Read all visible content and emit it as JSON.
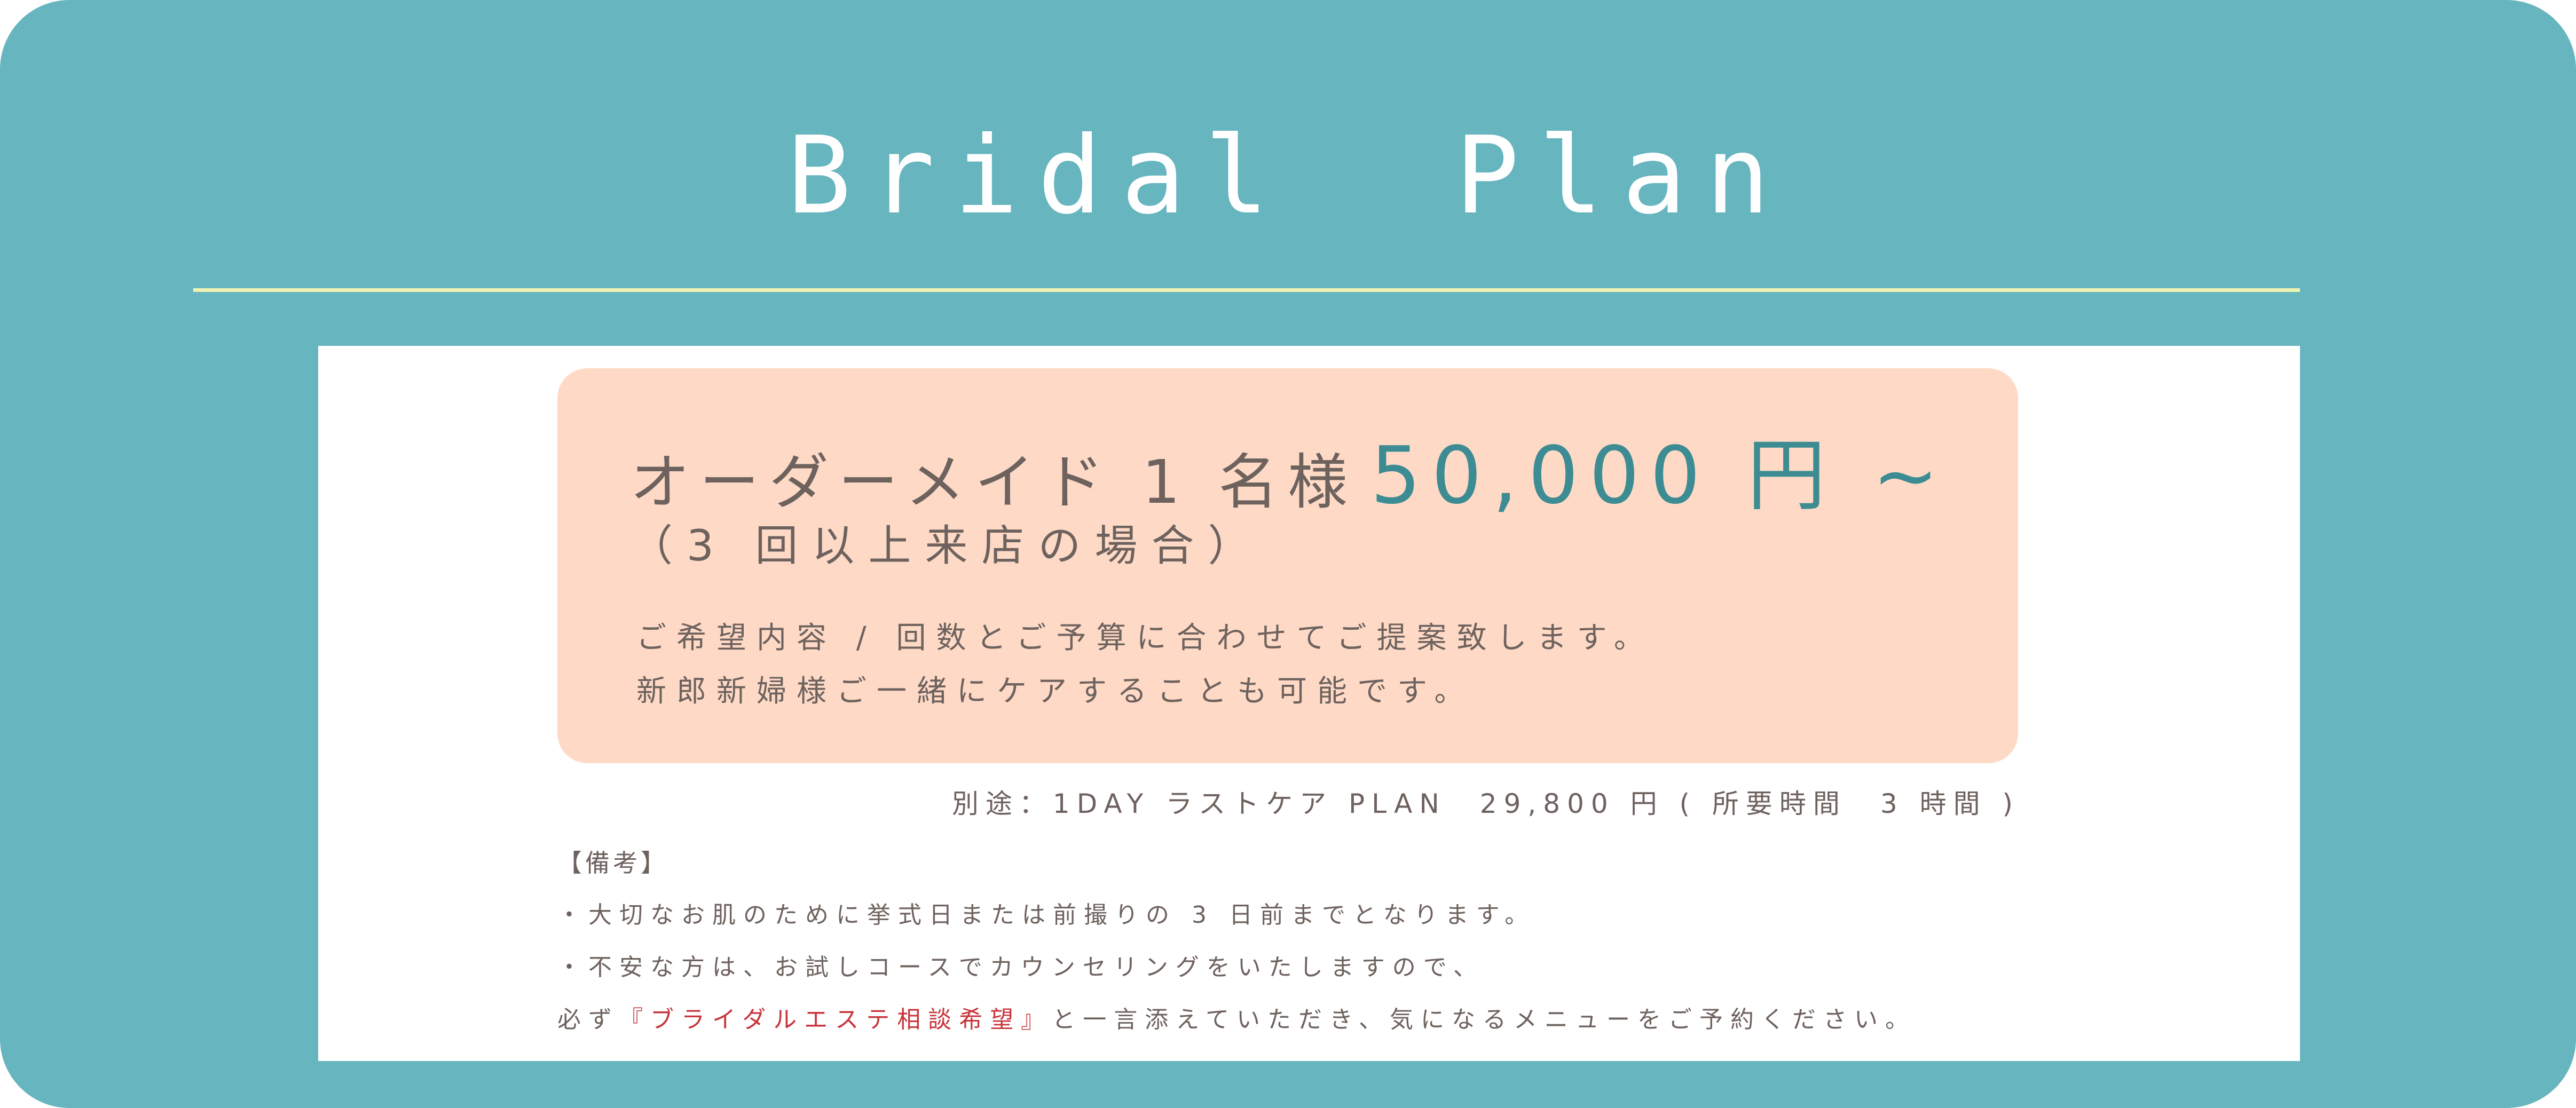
{
  "header": {
    "title": "Bridal  Plan"
  },
  "plan": {
    "name": "オーダーメイド 1 名様",
    "price": "50,000 円 ~",
    "condition": "（3 回以上来店の場合）",
    "description_lines": [
      "ご希望内容 / 回数とご予算に合わせてご提案致します。",
      "新郎新婦様ご一緒にケアすることも可能です。"
    ]
  },
  "extra_plan": "別途：1DAY ラストケア PLAN　29,800 円 ( 所要時間　3 時間 )",
  "notes": {
    "heading": "【備考】",
    "line1": "・大切なお肌のために挙式日または前撮りの 3 日前までとなります。",
    "line2": "・不安な方は、お試しコースでカウンセリングをいたしますので、",
    "line3_prefix": "必ず",
    "line3_highlight": "『ブライダルエステ相談希望』",
    "line3_suffix": "と一言添えていただき、気になるメニューをご予約ください。"
  },
  "colors": {
    "background": "#67b5bf",
    "divider": "#eef3b2",
    "price_box": "#fedac6",
    "price_text": "#3d8c93",
    "body_text": "#6e625e",
    "highlight": "#c8343b"
  }
}
